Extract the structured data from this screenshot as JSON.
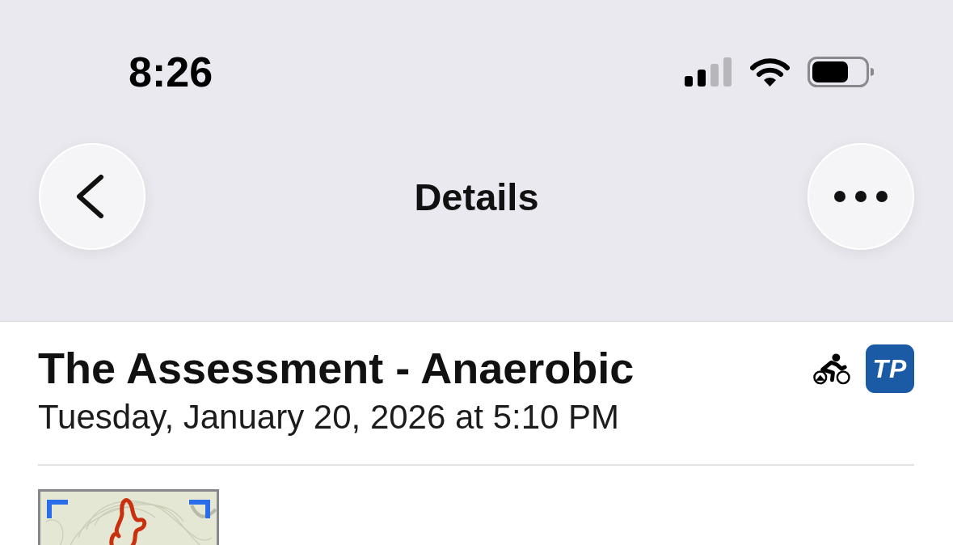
{
  "status_bar": {
    "time": "8:26"
  },
  "nav_bar": {
    "title": "Details"
  },
  "workout": {
    "title": "The Assessment - Anaerobic",
    "date": "Tuesday, January 20, 2026 at 5:10 PM",
    "logo": "TP"
  }
}
